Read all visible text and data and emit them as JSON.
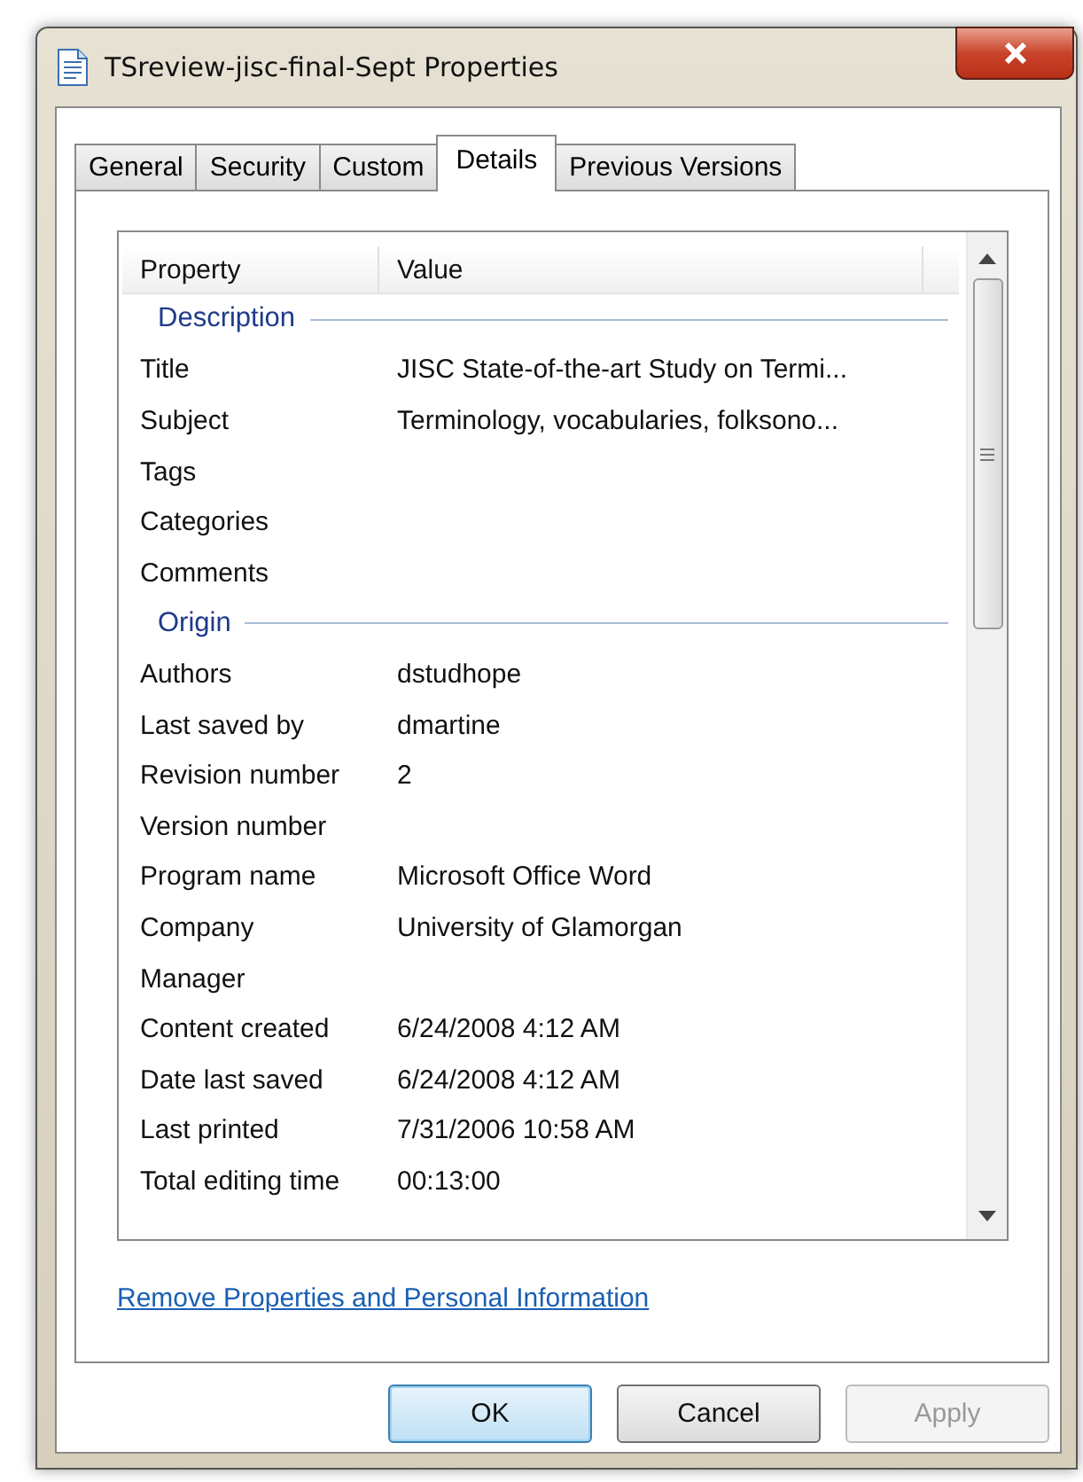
{
  "window": {
    "title": "TSreview-jisc-final-Sept Properties"
  },
  "tabs": [
    {
      "label": "General",
      "selected": false
    },
    {
      "label": "Security",
      "selected": false
    },
    {
      "label": "Custom",
      "selected": false
    },
    {
      "label": "Details",
      "selected": true
    },
    {
      "label": "Previous Versions",
      "selected": false
    }
  ],
  "table": {
    "columns": [
      "Property",
      "Value"
    ],
    "rows": [
      {
        "kind": "group",
        "property": "Description"
      },
      {
        "kind": "item",
        "property": "Title",
        "value": "JISC State-of-the-art Study on Termi..."
      },
      {
        "kind": "item",
        "property": "Subject",
        "value": "Terminology, vocabularies, folksono..."
      },
      {
        "kind": "item",
        "property": "Tags"
      },
      {
        "kind": "item",
        "property": "Categories"
      },
      {
        "kind": "item",
        "property": "Comments"
      },
      {
        "kind": "group",
        "property": "Origin"
      },
      {
        "kind": "item",
        "property": "Authors",
        "value": "dstudhope"
      },
      {
        "kind": "item",
        "property": "Last saved by",
        "value": "dmartine"
      },
      {
        "kind": "item",
        "property": "Revision number",
        "value": "2"
      },
      {
        "kind": "item",
        "property": "Version number"
      },
      {
        "kind": "item",
        "property": "Program name",
        "value": "Microsoft Office Word"
      },
      {
        "kind": "item",
        "property": "Company",
        "value": "University of Glamorgan"
      },
      {
        "kind": "item",
        "property": "Manager"
      },
      {
        "kind": "item",
        "property": "Content created",
        "value": "6/24/2008 4:12 AM"
      },
      {
        "kind": "item",
        "property": "Date last saved",
        "value": "6/24/2008 4:12 AM"
      },
      {
        "kind": "item",
        "property": "Last printed",
        "value": "7/31/2006 10:58 AM"
      },
      {
        "kind": "item",
        "property": "Total editing time",
        "value": "00:13:00"
      }
    ]
  },
  "link": "Remove Properties and Personal Information",
  "buttons": [
    {
      "label": "OK",
      "default": true,
      "disabled": false
    },
    {
      "label": "Cancel",
      "default": false,
      "disabled": false
    },
    {
      "label": "Apply",
      "default": false,
      "disabled": true
    }
  ]
}
